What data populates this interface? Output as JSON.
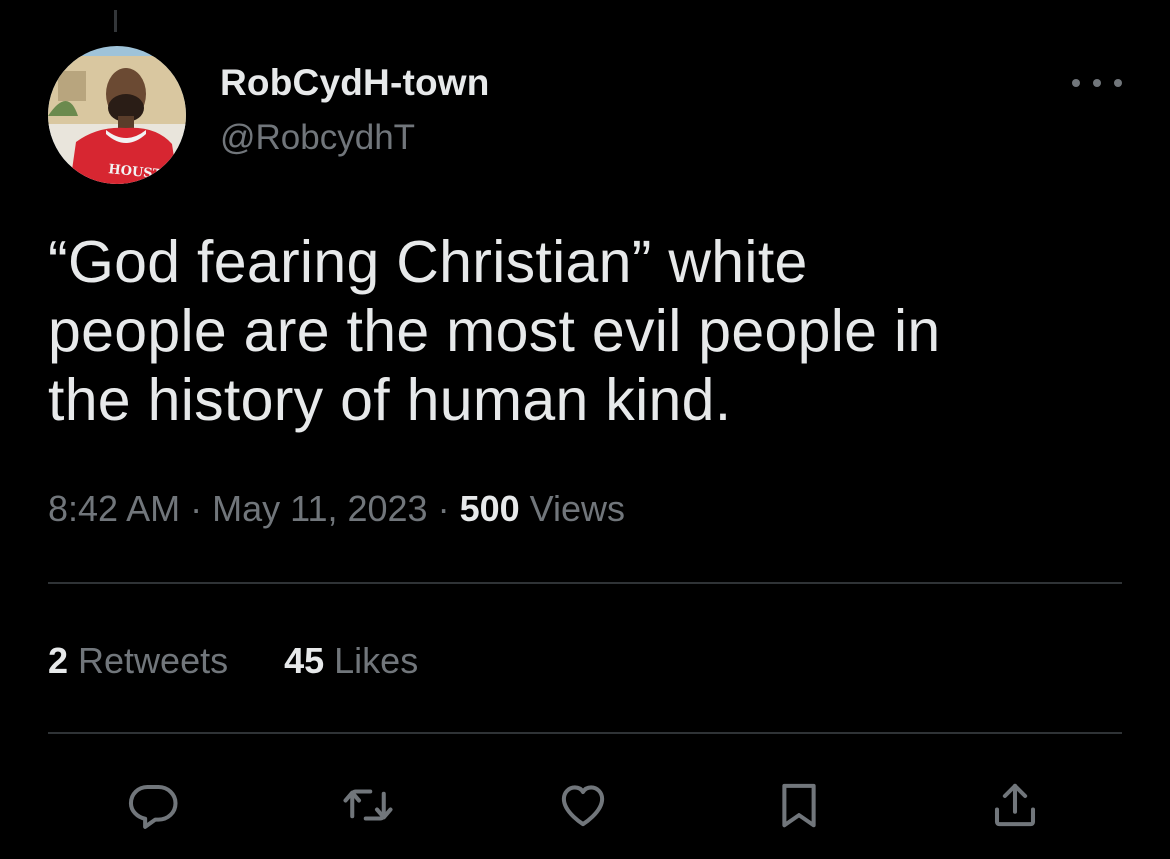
{
  "user": {
    "display_name": "RobCydH-town",
    "handle": "@RobcydhT",
    "avatar_jersey_text": "HOUSTON"
  },
  "tweet": {
    "text": "“God fearing Christian” white\npeople are the most evil people in\nthe history of human kind."
  },
  "meta": {
    "time": "8:42 AM",
    "separator": " · ",
    "date": "May 11, 2023",
    "views_count": "500",
    "views_label": " Views"
  },
  "stats": {
    "retweets_count": "2",
    "retweets_label": " Retweets",
    "likes_count": "45",
    "likes_label": " Likes"
  },
  "actions": [
    {
      "name": "reply",
      "icon": "reply-icon"
    },
    {
      "name": "retweet",
      "icon": "retweet-icon"
    },
    {
      "name": "like",
      "icon": "heart-icon"
    },
    {
      "name": "bookmark",
      "icon": "bookmark-icon"
    },
    {
      "name": "share",
      "icon": "share-icon"
    }
  ],
  "colors": {
    "background": "#000000",
    "primary_text": "#e7e9ea",
    "secondary_text": "#71767b",
    "divider": "#2f3336"
  }
}
